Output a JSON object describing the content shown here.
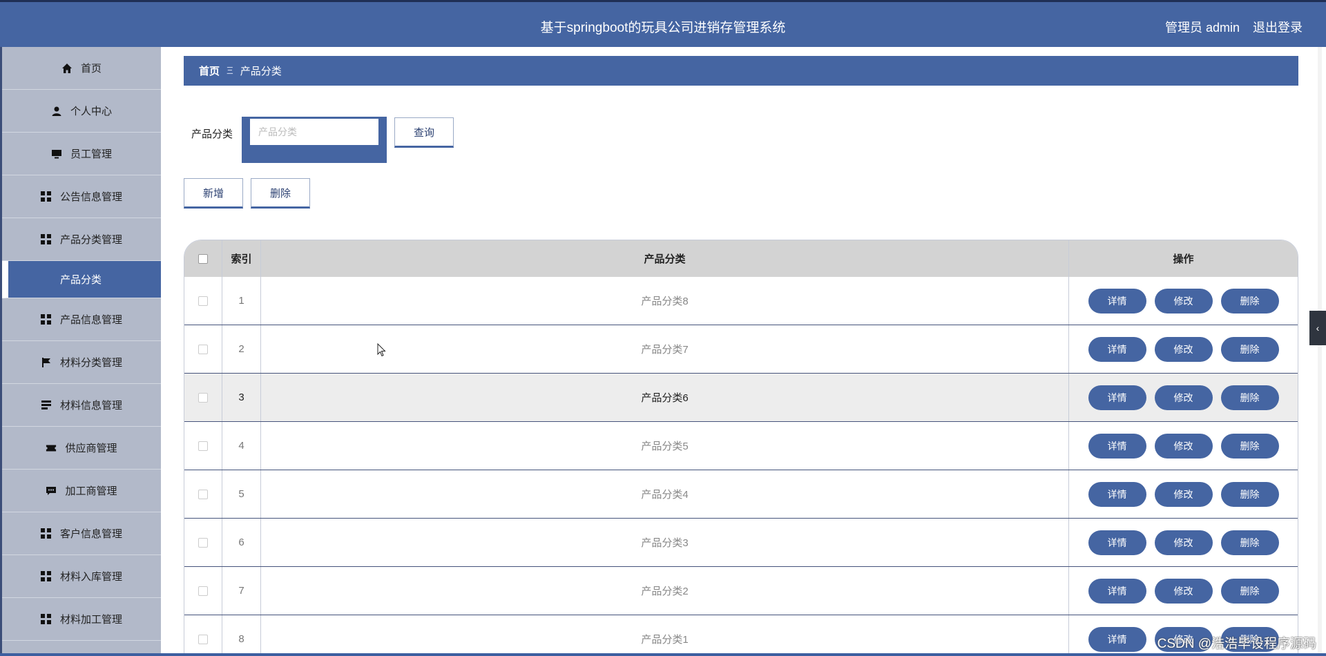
{
  "header": {
    "title": "基于springboot的玩具公司进销存管理系统",
    "user_label": "管理员 admin",
    "logout": "退出登录"
  },
  "sidebar": {
    "items": [
      {
        "label": "首页",
        "icon": "home-icon"
      },
      {
        "label": "个人中心",
        "icon": "user-icon"
      },
      {
        "label": "员工管理",
        "icon": "monitor-icon"
      },
      {
        "label": "公告信息管理",
        "icon": "grid-icon"
      },
      {
        "label": "产品分类管理",
        "icon": "grid-icon"
      },
      {
        "label": "产品分类",
        "icon": "",
        "active": true
      },
      {
        "label": "产品信息管理",
        "icon": "grid-icon"
      },
      {
        "label": "材料分类管理",
        "icon": "flag-icon"
      },
      {
        "label": "材料信息管理",
        "icon": "list-icon"
      },
      {
        "label": "供应商管理",
        "icon": "ticket-icon"
      },
      {
        "label": "加工商管理",
        "icon": "chat-icon"
      },
      {
        "label": "客户信息管理",
        "icon": "grid-icon"
      },
      {
        "label": "材料入库管理",
        "icon": "grid-icon"
      },
      {
        "label": "材料加工管理",
        "icon": "grid-icon"
      }
    ]
  },
  "breadcrumb": {
    "home": "首页",
    "separator": "Ξ",
    "current": "产品分类"
  },
  "search": {
    "label": "产品分类",
    "placeholder": "产品分类",
    "query_button": "查询"
  },
  "actions": {
    "add": "新增",
    "delete": "删除"
  },
  "table": {
    "columns": {
      "index": "索引",
      "name": "产品分类",
      "ops": "操作"
    },
    "rows": [
      {
        "index": "1",
        "name": "产品分类8"
      },
      {
        "index": "2",
        "name": "产品分类7"
      },
      {
        "index": "3",
        "name": "产品分类6",
        "highlight": true
      },
      {
        "index": "4",
        "name": "产品分类5"
      },
      {
        "index": "5",
        "name": "产品分类4"
      },
      {
        "index": "6",
        "name": "产品分类3"
      },
      {
        "index": "7",
        "name": "产品分类2"
      },
      {
        "index": "8",
        "name": "产品分类1"
      }
    ],
    "row_buttons": {
      "detail": "详情",
      "edit": "修改",
      "delete": "删除"
    }
  },
  "collapse_glyph": "‹",
  "watermark": "CSDN @浩浩毕设程序源码",
  "colors": {
    "primary": "#4565a2",
    "sidebar_bg": "#b2b9c9",
    "table_header": "#d3d3d3",
    "row_highlight": "#ededed"
  }
}
